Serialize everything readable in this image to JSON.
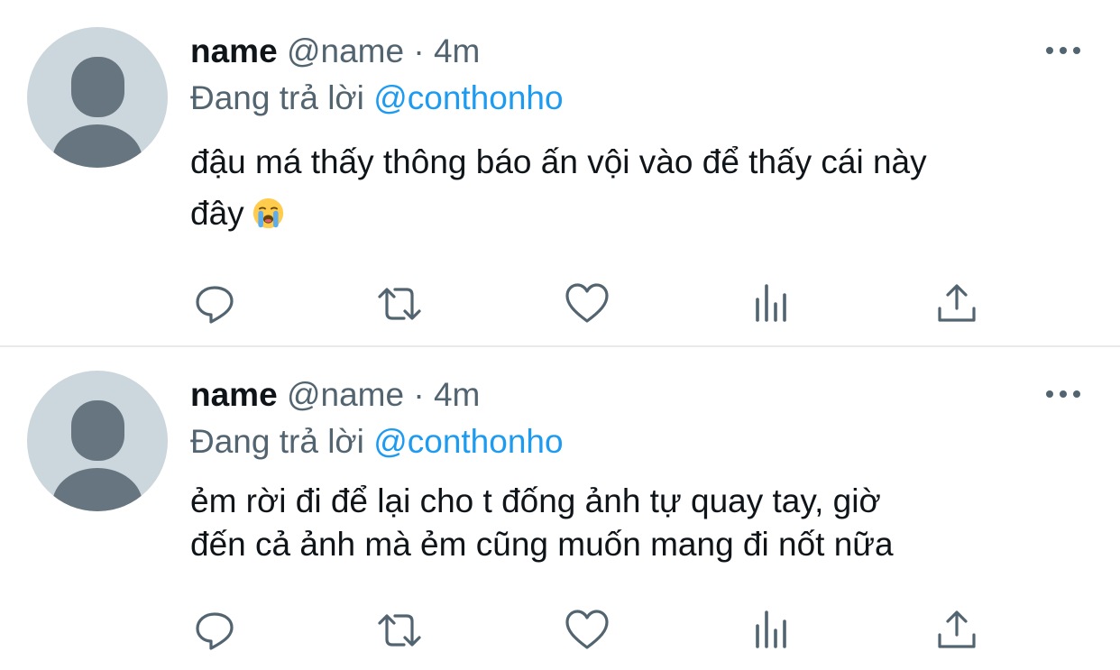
{
  "tweets": [
    {
      "display_name": "name",
      "handle": "@name",
      "separator": "·",
      "time": "4m",
      "reply_prefix": "Đang trả lời",
      "reply_to": "@conthonho",
      "text_lines": [
        "đậu má thấy thông báo ấn vội vào để thấy cái này",
        "đây"
      ],
      "emoji": "loudly-crying-face"
    },
    {
      "display_name": "name",
      "handle": "@name",
      "separator": "·",
      "time": "4m",
      "reply_prefix": "Đang trả lời",
      "reply_to": "@conthonho",
      "text_lines": [
        "ẻm rời đi để lại cho t đống ảnh tự quay tay, giờ",
        "đến cả ảnh mà ẻm cũng muốn mang đi nốt nữa"
      ]
    }
  ],
  "actions": [
    "reply-icon",
    "retweet-icon",
    "like-icon",
    "analytics-icon",
    "share-icon"
  ],
  "colors": {
    "accent": "#1d9bf0",
    "secondary_text": "#536471",
    "avatar_bg": "#ccd6dd",
    "avatar_fg": "#66757f"
  }
}
